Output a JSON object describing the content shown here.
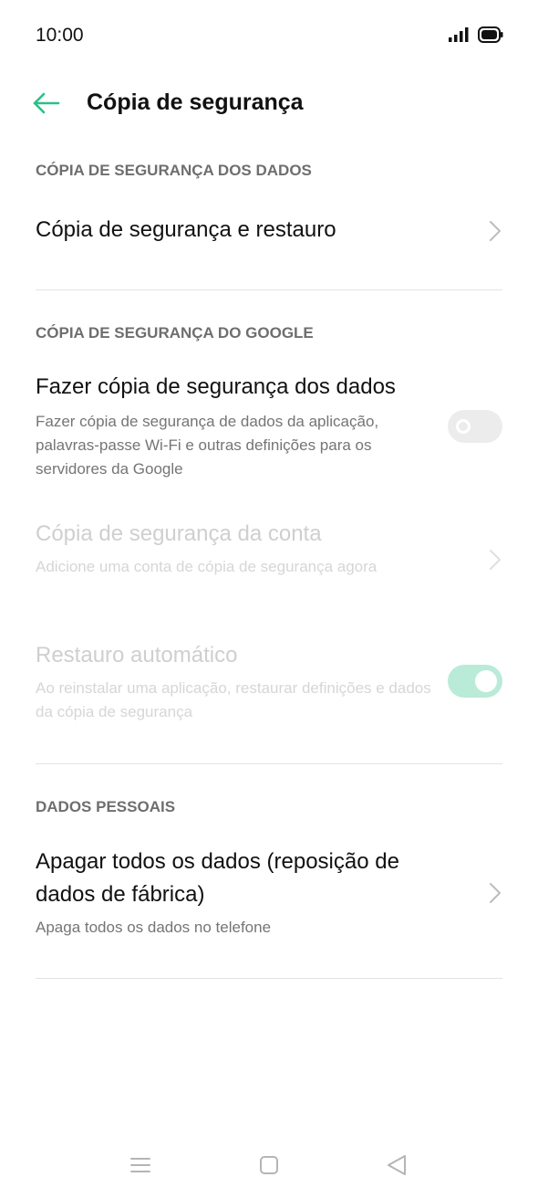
{
  "status_bar": {
    "time": "10:00",
    "signal_icon": "signal-icon",
    "battery_icon": "battery-icon"
  },
  "header": {
    "back_icon": "arrow-left-icon",
    "title": "Cópia de segurança"
  },
  "sections": {
    "data_backup": {
      "header": "CÓPIA DE SEGURANÇA DOS DADOS",
      "items": [
        {
          "title": "Cópia de segurança e restauro"
        }
      ]
    },
    "google_backup": {
      "header": "CÓPIA DE SEGURANÇA DO GOOGLE",
      "items": [
        {
          "title": "Fazer cópia de segurança dos dados",
          "subtitle": "Fazer cópia de segurança de dados da aplicação, palavras-passe Wi-Fi e outras definições para os servidores da Google",
          "toggle": false
        },
        {
          "title": "Cópia de segurança da conta",
          "subtitle": "Adicione uma conta de cópia de segurança agora",
          "disabled": true
        },
        {
          "title": "Restauro automático",
          "subtitle": "Ao reinstalar uma aplicação, restaurar definições e dados da cópia de segurança",
          "toggle": true,
          "disabled": true
        }
      ]
    },
    "personal_data": {
      "header": "DADOS PESSOAIS",
      "items": [
        {
          "title_line1": "Apagar todos os dados (reposição de",
          "title_line2": "dados de fábrica)",
          "subtitle": "Apaga todos os dados no telefone"
        }
      ]
    }
  },
  "colors": {
    "accent": "#2bbf8a",
    "toggle_on": "#b9ebd8",
    "toggle_off": "#ececec",
    "section_header": "#6e6e6e",
    "disabled_text": "#cfcfcf"
  },
  "nav_bar": {
    "menu_icon": "menu-icon",
    "home_icon": "home-icon",
    "back_icon": "back-triangle-icon"
  }
}
